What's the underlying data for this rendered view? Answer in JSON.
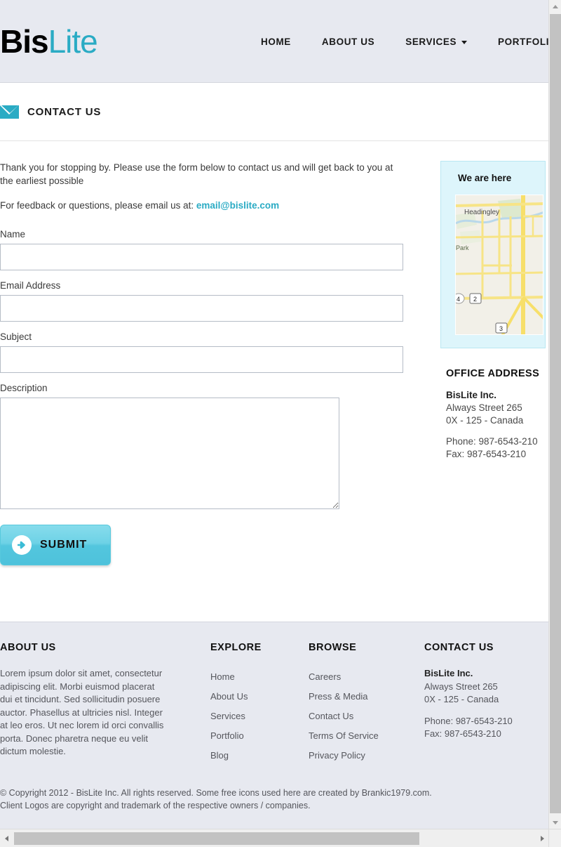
{
  "header": {
    "logo_primary": "Bis",
    "logo_secondary": "Lite",
    "nav": [
      {
        "label": "HOME",
        "has_dropdown": false
      },
      {
        "label": "ABOUT US",
        "has_dropdown": false
      },
      {
        "label": "SERVICES",
        "has_dropdown": true
      },
      {
        "label": "PORTFOLIO",
        "has_dropdown": true
      }
    ]
  },
  "page": {
    "title": "CONTACT US",
    "title_icon": "mail-icon"
  },
  "intro": {
    "paragraph1": "Thank you for stopping by. Please use the form below to contact us and will get back to you at the earliest possible",
    "paragraph2_prefix": "For feedback or questions, please email us at: ",
    "email": "email@bislite.com"
  },
  "form": {
    "fields": [
      {
        "label": "Name",
        "value": "",
        "placeholder": "",
        "type": "text"
      },
      {
        "label": "Email Address",
        "value": "",
        "placeholder": "",
        "type": "text"
      },
      {
        "label": "Subject",
        "value": "",
        "placeholder": "",
        "type": "text"
      },
      {
        "label": "Description",
        "value": "",
        "placeholder": "",
        "type": "textarea"
      }
    ],
    "submit_label": "SUBMIT",
    "submit_icon": "arrow-right-circle-icon"
  },
  "sidebar": {
    "map_title": "We are here",
    "map_labels": {
      "place": "Headingley",
      "park": "Park",
      "route_4": "4",
      "route_2": "2",
      "route_3": "3"
    },
    "office_heading": "OFFICE ADDRESS",
    "office": {
      "company": "BisLite Inc.",
      "street": "Always Street 265",
      "region": "0X - 125 - Canada",
      "phone": "Phone: 987-6543-210",
      "fax": "Fax: 987-6543-210"
    }
  },
  "footer": {
    "about": {
      "heading": "ABOUT US",
      "text": "Lorem ipsum dolor sit amet, consectetur adipiscing elit. Morbi euismod placerat dui et tincidunt. Sed sollicitudin posuere auctor. Phasellus at ultricies nisl. Integer at leo eros. Ut nec lorem id orci convallis porta. Donec pharetra neque eu velit dictum molestie."
    },
    "explore": {
      "heading": "EXPLORE",
      "links": [
        "Home",
        "About Us",
        "Services",
        "Portfolio",
        "Blog"
      ]
    },
    "browse": {
      "heading": "BROWSE",
      "links": [
        "Careers",
        "Press & Media",
        "Contact Us",
        "Terms Of Service",
        "Privacy Policy"
      ]
    },
    "contact": {
      "heading": "CONTACT US",
      "company": "BisLite Inc.",
      "street": "Always Street 265",
      "region": "0X - 125 - Canada",
      "phone": "Phone: 987-6543-210",
      "fax": "Fax: 987-6543-210"
    },
    "copyright_line1": "© Copyright 2012 - BisLite Inc. All rights reserved. Some free icons used here are created by Brankic1979.com.",
    "copyright_line2": "Client Logos are copyright and trademark of the respective owners / companies."
  },
  "colors": {
    "accent": "#2aabc4",
    "header_bg": "#e7e9f0",
    "map_card_bg": "#ddf5fb",
    "submit_bg": "#6ed2e6"
  }
}
